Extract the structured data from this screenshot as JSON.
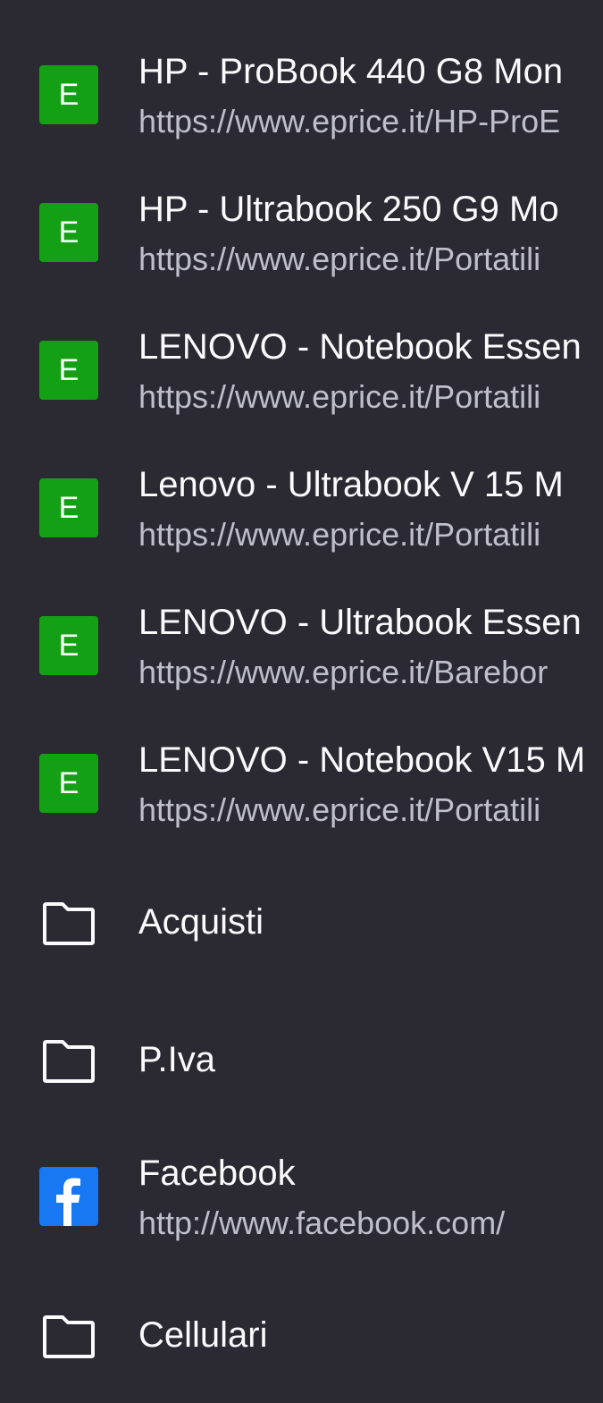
{
  "bookmarks": [
    {
      "type": "site",
      "icon": "eprice-icon",
      "icon_letter": "E",
      "title": "HP - ProBook 440 G8 Mon",
      "url": "https://www.eprice.it/HP-ProE"
    },
    {
      "type": "site",
      "icon": "eprice-icon",
      "icon_letter": "E",
      "title": "HP - Ultrabook 250 G9 Mo",
      "url": "https://www.eprice.it/Portatili"
    },
    {
      "type": "site",
      "icon": "eprice-icon",
      "icon_letter": "E",
      "title": "LENOVO - Notebook Essen",
      "url": "https://www.eprice.it/Portatili"
    },
    {
      "type": "site",
      "icon": "eprice-icon",
      "icon_letter": "E",
      "title": "Lenovo - Ultrabook V 15 M",
      "url": "https://www.eprice.it/Portatili"
    },
    {
      "type": "site",
      "icon": "eprice-icon",
      "icon_letter": "E",
      "title": "LENOVO - Ultrabook Essen",
      "url": "https://www.eprice.it/Barebor"
    },
    {
      "type": "site",
      "icon": "eprice-icon",
      "icon_letter": "E",
      "title": "LENOVO - Notebook V15 M",
      "url": "https://www.eprice.it/Portatili"
    },
    {
      "type": "folder",
      "icon": "folder-icon",
      "title": "Acquisti"
    },
    {
      "type": "folder",
      "icon": "folder-icon",
      "title": "P.Iva"
    },
    {
      "type": "site",
      "icon": "facebook-icon",
      "icon_letter": "f",
      "title": "Facebook",
      "url": "http://www.facebook.com/"
    },
    {
      "type": "folder",
      "icon": "folder-icon",
      "title": "Cellulari"
    }
  ],
  "colors": {
    "background": "#2b2a33",
    "eprice_green": "#14a014",
    "facebook_blue": "#1877f2",
    "title_text": "#fbfbfe",
    "url_text": "#bfbfc9"
  }
}
